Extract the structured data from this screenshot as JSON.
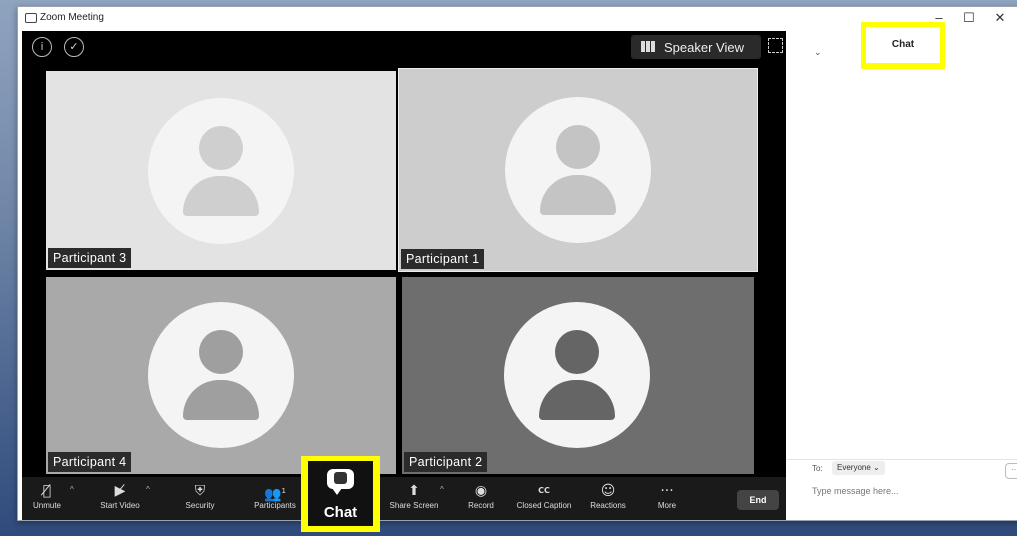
{
  "window": {
    "title": "Zoom Meeting",
    "minimize": "–",
    "maximize": "☐",
    "close": "✕"
  },
  "topbar": {
    "info_icon": "info-icon",
    "security_icon": "shield-icon",
    "speaker_view_label": "Speaker View"
  },
  "participants": [
    {
      "name": "Participant 3",
      "bg": "#e3e3e3",
      "avatar_fg": "#cfcfcf"
    },
    {
      "name": "Participant 1",
      "bg": "#cdcdcd",
      "avatar_fg": "#c4c4c4"
    },
    {
      "name": "Participant 4",
      "bg": "#a9a9a9",
      "avatar_fg": "#9f9f9f"
    },
    {
      "name": "Participant 2",
      "bg": "#6e6e6e",
      "avatar_fg": "#656565"
    }
  ],
  "toolbar": {
    "unmute": "Unmute",
    "start_video": "Start Video",
    "security": "Security",
    "participants": "Participants",
    "participants_count": "1",
    "chat": "Chat",
    "share_screen": "Share Screen",
    "record": "Record",
    "closed_caption": "Closed Caption",
    "reactions": "Reactions",
    "more": "More",
    "end": "End"
  },
  "chat_panel": {
    "tab_label": "Chat",
    "to_label": "To:",
    "recipient": "Everyone ⌄",
    "input_placeholder": "Type message here...",
    "more_label": "···"
  },
  "colors": {
    "highlight": "#ffff00",
    "video_bg": "#000000",
    "toolbar_bg": "#1a1a1a"
  }
}
